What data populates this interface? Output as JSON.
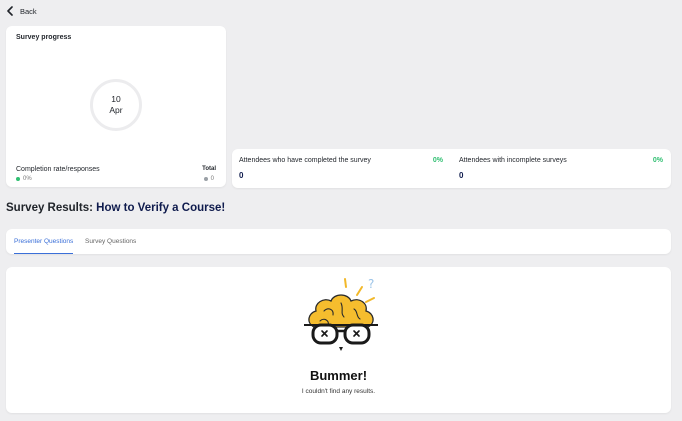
{
  "nav": {
    "back_label": "Back"
  },
  "progress": {
    "title": "Survey progress",
    "date_day": "10",
    "date_month": "Apr",
    "rate_label": "Completion rate/responses",
    "rate_value": "0%",
    "total_label": "Total",
    "total_value": "0",
    "colors": {
      "rate_dot": "#2fbf71",
      "total_dot": "#9aa0a6"
    }
  },
  "stats": [
    {
      "label": "Attendees who have completed the survey",
      "percent": "0%",
      "count": "0"
    },
    {
      "label": "Attendees with incomplete surveys",
      "percent": "0%",
      "count": "0"
    }
  ],
  "results": {
    "prefix": "Survey Results:",
    "course": "How to Verify a Course!"
  },
  "tabs": [
    {
      "label": "Presenter Questions",
      "active": true
    },
    {
      "label": "Survey Questions",
      "active": false
    }
  ],
  "empty": {
    "title": "Bummer!",
    "message": "I couldn't find any results.",
    "question_mark": "?"
  },
  "colors": {
    "accent": "#3a6fd8",
    "success": "#2fbf71",
    "navy": "#0f1b4d"
  }
}
